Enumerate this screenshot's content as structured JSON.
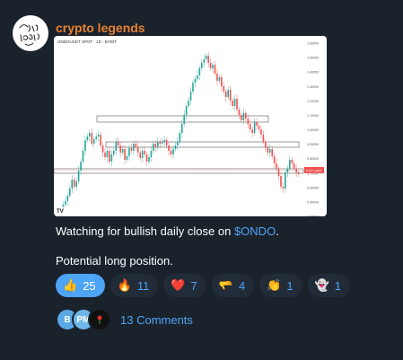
{
  "channel": {
    "name": "crypto legends",
    "avatar_text": "Crypto Legends"
  },
  "chart_image": {
    "header": "ONDOUSDT SPOT · 1D · BYBIT",
    "price_labels": [
      "1.60000",
      "1.50000",
      "1.40000",
      "1.30000",
      "1.20000",
      "1.10000",
      "1.00000",
      "0.90000",
      "0.80000",
      "0.70000",
      "0.60000",
      "0.50000",
      "0.40000"
    ],
    "current_price_label": "0.67 USD",
    "watermark": "TV",
    "colors": {
      "up": "#26a69a",
      "down": "#ef5350"
    }
  },
  "post": {
    "line1_prefix": "Watching for bullish daily close on ",
    "ticker": "$ONDO",
    "line1_suffix": ".",
    "line2": "Potential long position."
  },
  "reactions": [
    {
      "emoji": "👍",
      "count": "25",
      "active": true
    },
    {
      "emoji": "🔥",
      "count": "11",
      "active": false
    },
    {
      "emoji": "❤️",
      "count": "7",
      "active": false
    },
    {
      "emoji": "🫳",
      "count": "4",
      "active": false
    },
    {
      "emoji": "👏",
      "count": "1",
      "active": false
    },
    {
      "emoji": "👻",
      "count": "1",
      "active": false
    }
  ],
  "comments": {
    "avatars": [
      {
        "initials": "B",
        "color": "#5ba7e6"
      },
      {
        "initials": "PM",
        "color": "#6fb7e8"
      },
      {
        "initials": "",
        "color": "#111111"
      }
    ],
    "label": "13 Comments"
  }
}
